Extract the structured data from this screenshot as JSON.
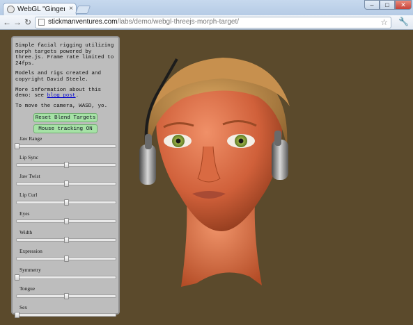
{
  "browser": {
    "tab_title": "WebGL \"Ginger\" manipula",
    "tab_close": "×",
    "url_host": "stickmanventures.com",
    "url_path": "/labs/demo/webgl-threejs-morph-target/",
    "window_min": "–",
    "window_max": "□",
    "window_close": "✕",
    "back": "←",
    "forward": "→",
    "reload": "↻",
    "star": "☆",
    "wrench": "🔧"
  },
  "panel": {
    "intro": "Simple facial rigging utilizing morph targets powered by three.js. Frame rate limited to 24fps.",
    "credits": "Models and rigs created and copyright David Steele.",
    "more_info_prefix": "More information about this demo: see",
    "blog_link": "blog post",
    "more_info_suffix": ".",
    "camera_hint": "To move the camera, WASD, yo.",
    "reset_button": "Reset Blend Targets",
    "mouse_button": "Mouse tracking ON",
    "sliders": [
      {
        "label": "Jaw Range",
        "value": 0.0
      },
      {
        "label": "Lip Sync",
        "value": 0.5
      },
      {
        "label": "Jaw Twist",
        "value": 0.5
      },
      {
        "label": "Lip Curl",
        "value": 0.5
      },
      {
        "label": "Eyes",
        "value": 0.5
      },
      {
        "label": "Width",
        "value": 0.5
      },
      {
        "label": "Expression",
        "value": 0.5
      },
      {
        "label": "Symmetry",
        "value": 0.0
      },
      {
        "label": "Tongue",
        "value": 0.5
      },
      {
        "label": "Sex",
        "value": 0.0
      }
    ]
  },
  "colors": {
    "background": "#5b4a2c",
    "button_green": "#a6e2a6"
  }
}
